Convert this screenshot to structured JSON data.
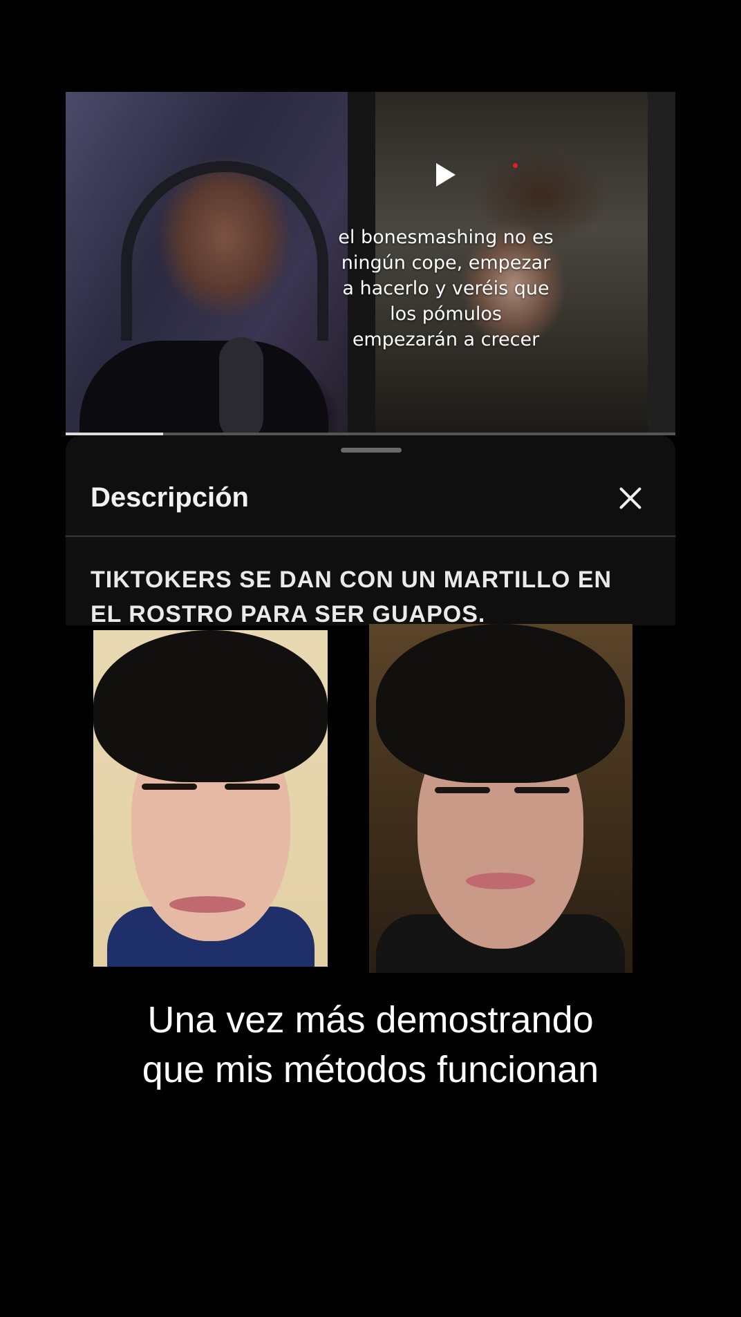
{
  "video": {
    "overlay_lines": [
      "el bonesmashing no es",
      "ningún cope, empezar",
      "a hacerlo y veréis que",
      "los pómulos",
      "empezarán a crecer"
    ],
    "progress": 0.16
  },
  "description_sheet": {
    "title": "Descripción",
    "body_lines": [
      "TIKTOKERS SE DAN CON UN MARTILLO EN",
      "EL ROSTRO PARA SER GUAPOS."
    ]
  },
  "caption_lines": [
    "Una vez más demostrando",
    "que mis métodos funcionan"
  ],
  "colors": {
    "background": "#000000",
    "sheet": "#0f0f0f",
    "text": "#ffffff",
    "red_dot": "#e0202a"
  },
  "icons": [
    "play-icon",
    "close-icon"
  ]
}
